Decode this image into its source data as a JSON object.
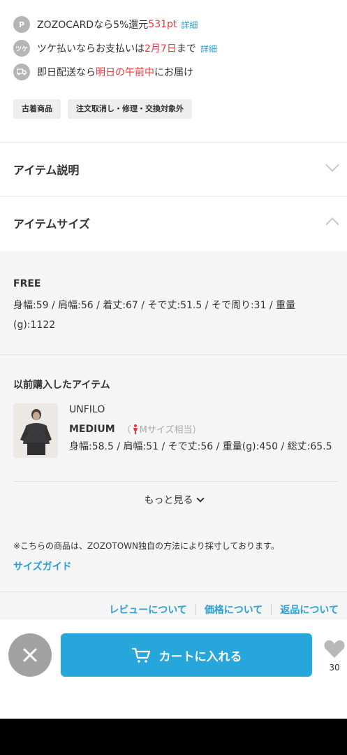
{
  "promos": [
    {
      "icon": "points-icon",
      "pre": "ZOZOCARDなら5%還元 ",
      "highlight": "531pt",
      "post": "",
      "link": "詳細"
    },
    {
      "icon": "tsuke-icon",
      "pre": "ツケ払いならお支払いは",
      "highlight": "2月7日",
      "post": "まで",
      "link": "詳細"
    },
    {
      "icon": "delivery-icon",
      "pre": "即日配送なら",
      "highlight": "明日の午前中",
      "post": "にお届け",
      "link": ""
    }
  ],
  "tags": [
    "古着商品",
    "注文取消し・修理・交換対象外"
  ],
  "accordion": {
    "description_label": "アイテム説明",
    "size_label": "アイテムサイズ"
  },
  "size": {
    "label": "FREE",
    "detail": "身幅:59 / 肩幅:56 / 着丈:67 / そで丈:51.5 / そで周り:31 / 重量(g):1122"
  },
  "previous": {
    "title": "以前購入したアイテム",
    "brand": "UNFILO",
    "size_label": "MEDIUM",
    "size_note": "Mサイズ相当",
    "detail": "身幅:58.5 / 肩幅:51 / そで丈:56 / 重量(g):450 / 総丈:65.5",
    "more_label": "もっと見る"
  },
  "note": "※こちらの商品は、ZOZOTOWN独自の方法により採寸しております。",
  "size_guide": "サイズガイド",
  "footer_links": [
    "レビューについて",
    "価格について",
    "返品について"
  ],
  "bottom_bar": {
    "cart_label": "カートに入れる",
    "fav_count": "30"
  },
  "colors": {
    "accent_blue": "#27a6dc",
    "link_blue": "#2a9fd8",
    "highlight_red": "#e8383d",
    "panel_gray": "#f5f5f5"
  }
}
